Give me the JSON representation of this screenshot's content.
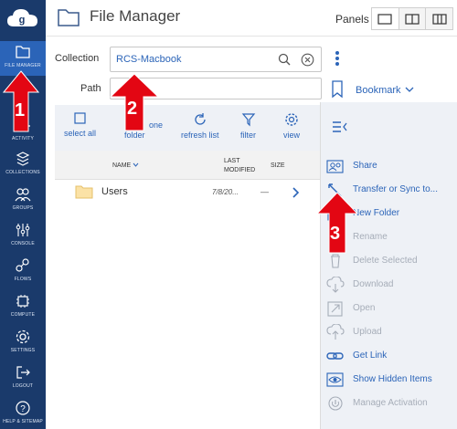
{
  "app": {
    "title": "File Manager"
  },
  "sidebar": {
    "items": [
      {
        "label": "FILE MANAGER",
        "icon": "folder-icon",
        "active": true
      },
      {
        "label": "ACTIVITY",
        "icon": "activity-icon"
      },
      {
        "label": "COLLECTIONS",
        "icon": "collections-icon"
      },
      {
        "label": "GROUPS",
        "icon": "groups-icon"
      },
      {
        "label": "CONSOLE",
        "icon": "console-icon"
      },
      {
        "label": "FLOWS",
        "icon": "flows-icon"
      },
      {
        "label": "COMPUTE",
        "icon": "compute-icon"
      },
      {
        "label": "SETTINGS",
        "icon": "settings-icon"
      },
      {
        "label": "LOGOUT",
        "icon": "logout-icon"
      },
      {
        "label": "HELP & SITEMAP",
        "icon": "help-icon"
      }
    ]
  },
  "header": {
    "panels_label": "Panels"
  },
  "form": {
    "collection_label": "Collection",
    "collection_value": "RCS-Macbook",
    "path_label": "Path",
    "path_value": "",
    "bookmark_label": "Bookmark"
  },
  "toolbar": {
    "select_all": "select all",
    "up_one": "one",
    "up_folder": "folder",
    "refresh": "refresh list",
    "filter": "filter",
    "view": "view"
  },
  "list": {
    "columns": {
      "name": "NAME",
      "modified_1": "LAST",
      "modified_2": "MODIFIED",
      "size": "SIZE"
    },
    "rows": [
      {
        "name": "Users",
        "modified": "7/8/20...",
        "size": "—"
      }
    ]
  },
  "actions": [
    {
      "label": "Share",
      "icon": "share-icon",
      "enabled": true
    },
    {
      "label": "Transfer or Sync to...",
      "icon": "transfer-icon",
      "enabled": true
    },
    {
      "label": "New Folder",
      "icon": "new-folder-icon",
      "enabled": true
    },
    {
      "label": "Rename",
      "icon": "rename-icon",
      "enabled": false
    },
    {
      "label": "Delete Selected",
      "icon": "delete-icon",
      "enabled": false
    },
    {
      "label": "Download",
      "icon": "download-icon",
      "enabled": false
    },
    {
      "label": "Open",
      "icon": "open-icon",
      "enabled": false
    },
    {
      "label": "Upload",
      "icon": "upload-icon",
      "enabled": false
    },
    {
      "label": "Get Link",
      "icon": "link-icon",
      "enabled": true
    },
    {
      "label": "Show Hidden Items",
      "icon": "eye-icon",
      "enabled": true
    },
    {
      "label": "Manage Activation",
      "icon": "power-icon",
      "enabled": false
    }
  ],
  "annotations": [
    {
      "label": "1"
    },
    {
      "label": "2"
    },
    {
      "label": "3"
    }
  ],
  "colors": {
    "nav_bg": "#1a3a6b",
    "nav_active": "#2b64b8",
    "link": "#2b64b8",
    "annotation": "#e30613"
  }
}
